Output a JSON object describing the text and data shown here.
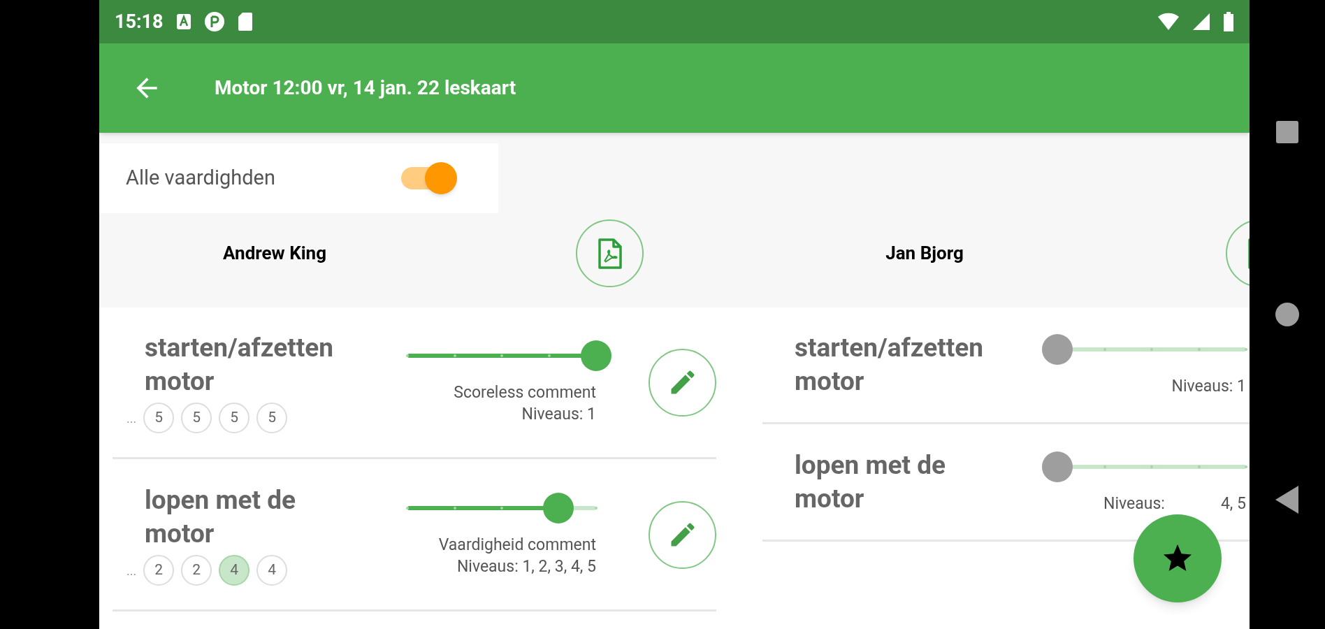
{
  "status_bar": {
    "time": "15:18"
  },
  "app_bar": {
    "title": "Motor 12:00 vr, 14 jan. 22 leskaart"
  },
  "filter": {
    "label": "Alle vaardighden",
    "on": true
  },
  "students": [
    {
      "name": "Andrew King",
      "skills": [
        {
          "title": "starten/afzetten motor",
          "chips_prefix": "...",
          "chips": [
            {
              "label": "5",
              "selected": false
            },
            {
              "label": "5",
              "selected": false
            },
            {
              "label": "5",
              "selected": false
            },
            {
              "label": "5",
              "selected": false
            }
          ],
          "slider": {
            "level": 1,
            "disabled": false
          },
          "comment": "Scoreless comment",
          "levels_text": [
            "Niveaus: 1"
          ],
          "edit_button": true
        },
        {
          "title": "lopen met de motor",
          "chips_prefix": "...",
          "chips": [
            {
              "label": "2",
              "selected": false
            },
            {
              "label": "2",
              "selected": false
            },
            {
              "label": "4",
              "selected": true
            },
            {
              "label": "4",
              "selected": false
            }
          ],
          "slider": {
            "level": 0.8,
            "disabled": false
          },
          "comment": "Vaardigheid comment",
          "levels_text": [
            "Niveaus: 1, 2, 3, 4, 5"
          ],
          "edit_button": true
        }
      ]
    },
    {
      "name": "Jan Bjorg",
      "skills": [
        {
          "title": "starten/afzetten motor",
          "slider": {
            "level": 0,
            "disabled": true
          },
          "levels_text": [
            "Niveaus: 1"
          ]
        },
        {
          "title": "lopen met de motor",
          "slider": {
            "level": 0,
            "disabled": true
          },
          "levels_text": [
            "Niveaus:",
            "4, 5"
          ]
        }
      ]
    }
  ]
}
